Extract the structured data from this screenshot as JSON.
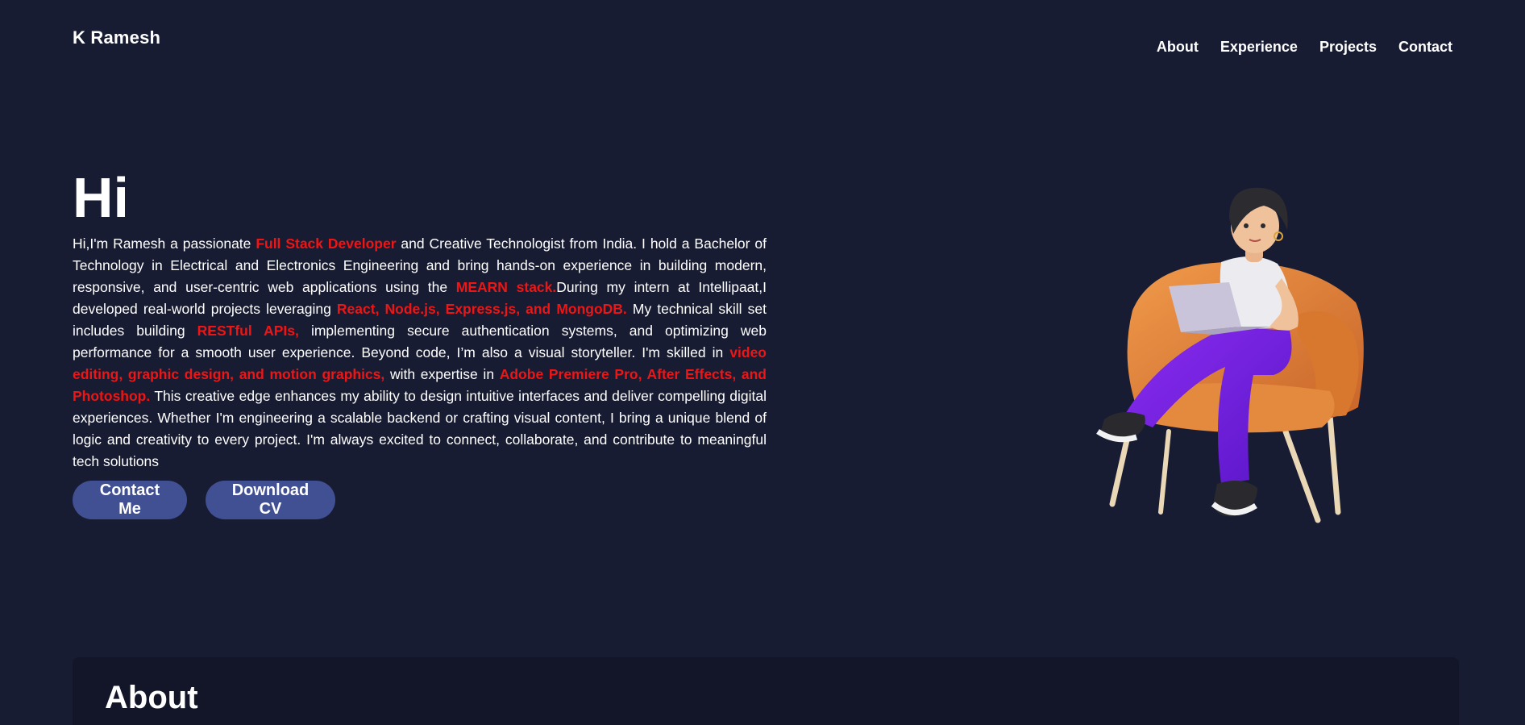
{
  "header": {
    "brand": "K Ramesh",
    "nav": [
      "About",
      "Experience",
      "Projects",
      "Contact"
    ]
  },
  "hero": {
    "title": "Hi",
    "intro": [
      {
        "t": "Hi,I'm Ramesh a passionate "
      },
      {
        "t": "Full Stack Developer",
        "h": true
      },
      {
        "t": " and Creative Technologist from India. I hold a Bachelor of Technology in Electrical and Electronics Engineering and bring hands-on experience in building modern, responsive, and user-centric web applications using the "
      },
      {
        "t": "MEARN stack.",
        "h": true
      },
      {
        "t": "During my intern at Intellipaat,I developed real-world projects leveraging "
      },
      {
        "t": "React, Node.js, Express.js, and MongoDB.",
        "h": true
      },
      {
        "t": " My technical skill set includes building "
      },
      {
        "t": "RESTful APIs,",
        "h": true
      },
      {
        "t": " implementing secure authentication systems, and optimizing web performance for a smooth user experience. Beyond code, I’m also a visual storyteller. I'm skilled in "
      },
      {
        "t": "video editing, graphic design, and motion graphics,",
        "h": true
      },
      {
        "t": " with expertise in "
      },
      {
        "t": "Adobe Premiere Pro, After Effects, and Photoshop.",
        "h": true
      },
      {
        "t": " This creative edge enhances my ability to design intuitive interfaces and deliver compelling digital experiences. Whether I'm engineering a scalable backend or crafting visual content, I bring a unique blend of logic and creativity to every project. I'm always excited to connect, collaborate, and contribute to meaningful tech solutions"
      }
    ],
    "buttons": {
      "contact": "Contact Me",
      "cv": "Download CV"
    },
    "illustration_icon": "woman-with-laptop-in-chair-illustration"
  },
  "about": {
    "title": "About"
  },
  "colors": {
    "background": "#181c33",
    "highlight": "#ee1515",
    "button": "#414f93",
    "card": "#121628"
  }
}
